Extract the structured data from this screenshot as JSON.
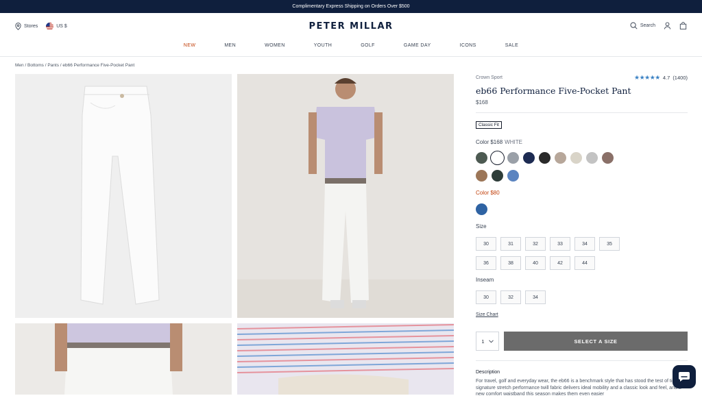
{
  "promo": {
    "text": "Complimentary Express Shipping on Orders Over $500"
  },
  "header": {
    "stores_label": "Stores",
    "currency_label": "US $",
    "logo": "PETER MILLAR",
    "search_label": "Search"
  },
  "nav": [
    "NEW",
    "MEN",
    "WOMEN",
    "YOUTH",
    "GOLF",
    "GAME DAY",
    "ICONS",
    "SALE"
  ],
  "breadcrumb": "Men / Bottoms / Pants / eb66 Performance Five-Pocket Pant",
  "product": {
    "brand": "Crown Sport",
    "stars": "★★★★★",
    "rating": "4.7",
    "reviews": "(1400)",
    "title": "eb66 Performance Five-Pocket Pant",
    "price": "$168",
    "fit": "Classic Fit",
    "color_label": "Color $168",
    "color_selected": "WHITE",
    "swatches_row1": [
      "#4d5a52",
      "#ffffff",
      "#9aa0a8",
      "#1d2b52",
      "#2a2a2a",
      "#b7a79a",
      "#d9d4c8",
      "#c3c3c3",
      "#8a7068"
    ],
    "swatches_row2": [
      "#9c7658",
      "#2e3d39",
      "#5b84c0"
    ],
    "sale_label": "Color $80",
    "sale_swatches": [
      "#2f63a3"
    ],
    "size_label": "Size",
    "sizes_row1": [
      "30",
      "31",
      "32",
      "33",
      "34",
      "35"
    ],
    "sizes_row2": [
      "36",
      "38",
      "40",
      "42",
      "44"
    ],
    "inseam_label": "Inseam",
    "inseams": [
      "30",
      "32",
      "34"
    ],
    "size_chart": "Size Chart",
    "qty": "1",
    "cta": "SELECT A SIZE",
    "description_heading": "Description",
    "description": "For travel, golf and everyday wear, the eb66 is a benchmark style that has stood the test of time. A signature stretch performance twill fabric delivers ideal mobility and a classic look and feel, and a new comfort waistband this season makes them even easier"
  },
  "colors": {
    "promo_bg": "#0f1f3d",
    "accent": "#c2410c",
    "cta_bg": "#6b6b6b",
    "star": "#3b82c4"
  }
}
